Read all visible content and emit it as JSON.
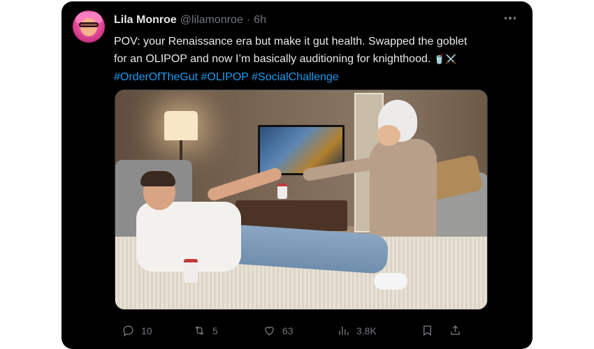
{
  "tweet": {
    "author": {
      "name": "Lila Monroe",
      "handle": "@lilamonroe",
      "separator": "·",
      "time": "6h"
    },
    "text": {
      "body": "POV: your Renaissance era but make it gut health. Swapped the goblet for an OLIPOP and now I’m basically auditioning for knighthood.",
      "emoji": "🥤⚔️",
      "hashtags": [
        "#OrderOfTheGut",
        "#OLIPOP",
        "#SocialChallenge"
      ]
    },
    "media": {
      "alt_visible": ""
    },
    "stats": {
      "replies": "10",
      "retweets": "5",
      "likes": "63",
      "views": "3.8K"
    },
    "icons": {
      "reply": "reply-icon",
      "retweet": "retweet-icon",
      "like": "heart-icon",
      "views": "views-icon",
      "bookmark": "bookmark-icon",
      "share": "share-icon",
      "more": "more-icon"
    },
    "colors": {
      "background": "#000000",
      "primary_text": "#e7e9ea",
      "secondary_text": "#71767b",
      "link": "#1d9bf0"
    }
  }
}
